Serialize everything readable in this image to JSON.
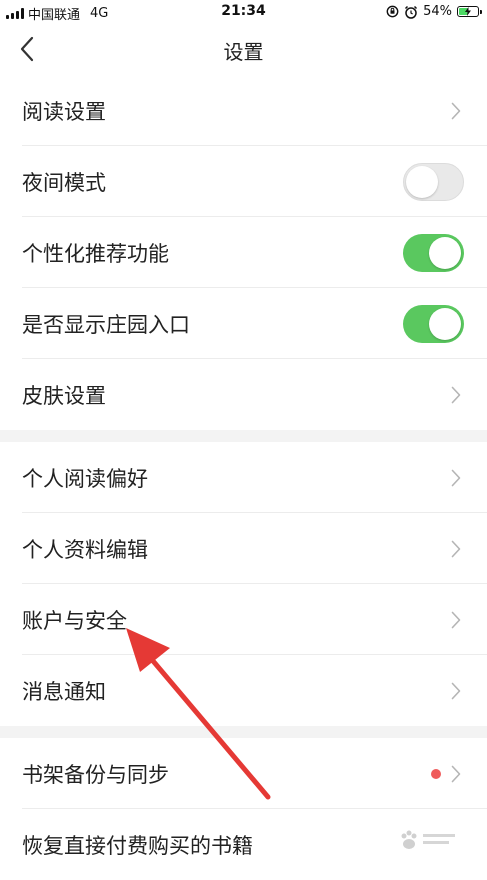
{
  "status_bar": {
    "carrier": "中国联通",
    "network": "4G",
    "time": "21:34",
    "battery_percent": "54%",
    "battery_level": 0.54
  },
  "nav": {
    "title": "设置"
  },
  "section1": [
    {
      "label": "阅读设置",
      "control": "chevron"
    },
    {
      "label": "夜间模式",
      "control": "toggle",
      "on": false
    },
    {
      "label": "个性化推荐功能",
      "control": "toggle",
      "on": true
    },
    {
      "label": "是否显示庄园入口",
      "control": "toggle",
      "on": true
    },
    {
      "label": "皮肤设置",
      "control": "chevron"
    }
  ],
  "section2": [
    {
      "label": "个人阅读偏好",
      "control": "chevron"
    },
    {
      "label": "个人资料编辑",
      "control": "chevron"
    },
    {
      "label": "账户与安全",
      "control": "chevron"
    },
    {
      "label": "消息通知",
      "control": "chevron"
    }
  ],
  "section3": [
    {
      "label": "书架备份与同步",
      "control": "chevron",
      "badge": true
    },
    {
      "label": "恢复直接付费购买的书籍",
      "control": "chevron"
    }
  ],
  "colors": {
    "toggle_on": "#5ac85f",
    "toggle_off": "#e9e9e9",
    "badge": "#ef5b5b",
    "annotation_arrow": "#e53935"
  }
}
